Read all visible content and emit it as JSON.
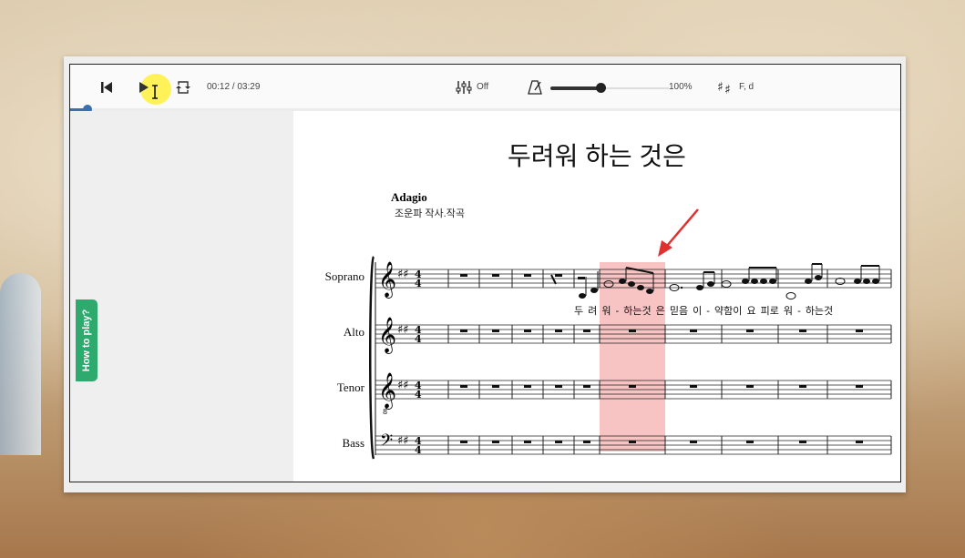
{
  "player": {
    "time": "00:12 / 03:29",
    "progress": 0.021,
    "mixer_label": "Off",
    "tempo_percent": "100%",
    "tempo_level": 0.42,
    "key_label": "F, d"
  },
  "side_tab": {
    "label": "How to play?"
  },
  "score": {
    "title": "두려워 하는 것은",
    "tempo_marking": "Adagio",
    "composer": "조운파 작사.작곡",
    "parts": [
      "Soprano",
      "Alto",
      "Tenor",
      "Bass"
    ],
    "lyrics": "두 려 워  -  하는것  은    믿음  이  - 약함이  요    피로 워  - 하는것"
  },
  "colors": {
    "accent": "#3a6fb0",
    "highlight": "#f7c3c3",
    "tab_green": "#2faa6f",
    "arrow": "#e03131"
  }
}
